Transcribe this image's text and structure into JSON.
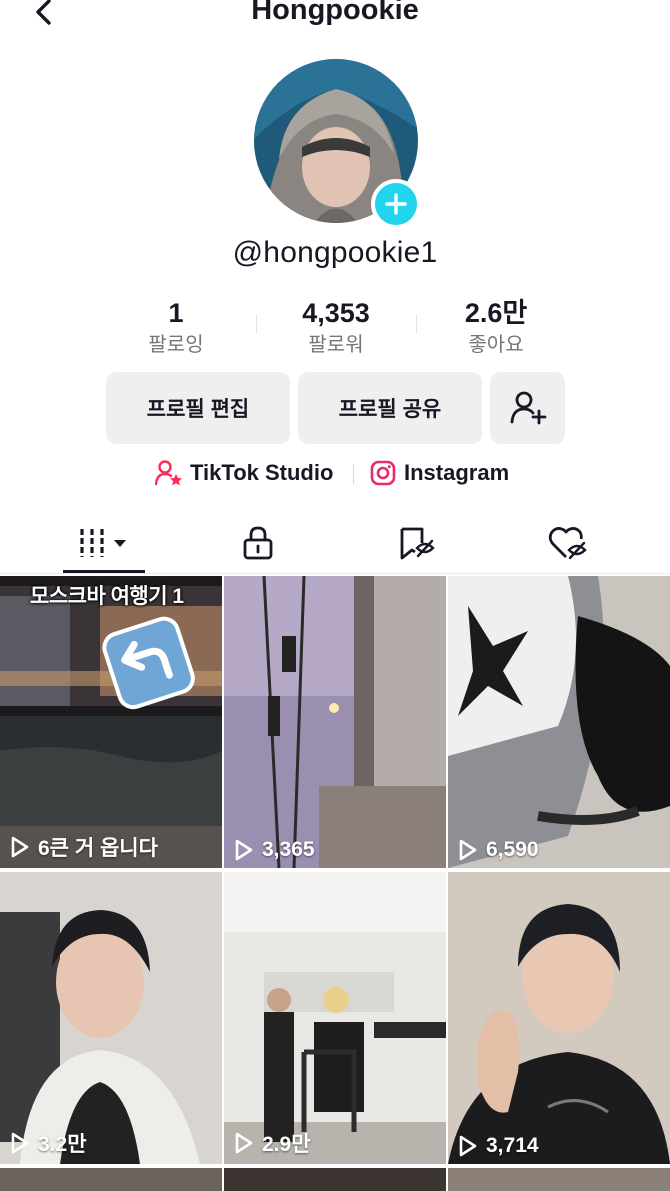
{
  "header": {
    "title": "Hongpookie",
    "back_icon": "chevron-left-icon"
  },
  "profile": {
    "username": "@hongpookie1",
    "plus_color": "#20d5ec"
  },
  "stats": [
    {
      "value": "1",
      "label": "팔로잉"
    },
    {
      "value": "4,353",
      "label": "팔로워"
    },
    {
      "value": "2.6만",
      "label": "좋아요"
    }
  ],
  "actions": {
    "edit_label": "프로필 편집",
    "share_label": "프로필 공유",
    "add_friend_icon": "add-user-icon"
  },
  "links": {
    "studio_label": "TikTok Studio",
    "instagram_label": "Instagram",
    "accent": "#fe2c55"
  },
  "tabs": [
    "videos-grid-icon",
    "lock-icon",
    "bookmark-hidden-icon",
    "heart-hidden-icon"
  ],
  "videos": [
    {
      "caption": "모스크바 여행기 1",
      "views": "6큰 거 옵니다"
    },
    {
      "views": "3,365"
    },
    {
      "views": "6,590"
    },
    {
      "views": "3.2만"
    },
    {
      "views": "2.9만"
    },
    {
      "views": "3,714"
    }
  ]
}
